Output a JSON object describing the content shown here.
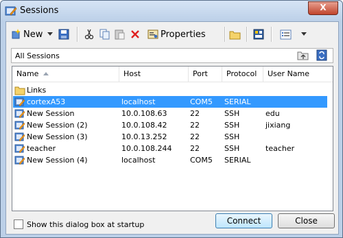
{
  "window": {
    "title": "Sessions",
    "close_glyph": "X"
  },
  "toolbar": {
    "new_label": "New",
    "properties_label": "Properties"
  },
  "path": {
    "text": "All Sessions"
  },
  "columns": [
    "Name",
    "Host",
    "Port",
    "Protocol",
    "User Name"
  ],
  "rows": [
    {
      "type": "folder",
      "name": "Links",
      "host": "",
      "port": "",
      "protocol": "",
      "user": ""
    },
    {
      "type": "session",
      "name": "cortexA53",
      "host": "localhost",
      "port": "COM5",
      "protocol": "SERIAL",
      "user": "",
      "selected": true
    },
    {
      "type": "session",
      "name": "New Session",
      "host": "10.0.108.63",
      "port": "22",
      "protocol": "SSH",
      "user": "edu"
    },
    {
      "type": "session",
      "name": "New Session (2)",
      "host": "10.0.108.42",
      "port": "22",
      "protocol": "SSH",
      "user": "jixiang"
    },
    {
      "type": "session",
      "name": "New Session (3)",
      "host": "10.0.13.252",
      "port": "22",
      "protocol": "SSH",
      "user": ""
    },
    {
      "type": "session",
      "name": "teacher",
      "host": "10.0.108.244",
      "port": "22",
      "protocol": "SSH",
      "user": "teacher"
    },
    {
      "type": "session",
      "name": "New Session (4)",
      "host": "localhost",
      "port": "COM5",
      "protocol": "SERIAL",
      "user": ""
    }
  ],
  "footer": {
    "startup_checkbox_label": "Show this dialog box at startup",
    "connect_label": "Connect",
    "close_label": "Close"
  }
}
